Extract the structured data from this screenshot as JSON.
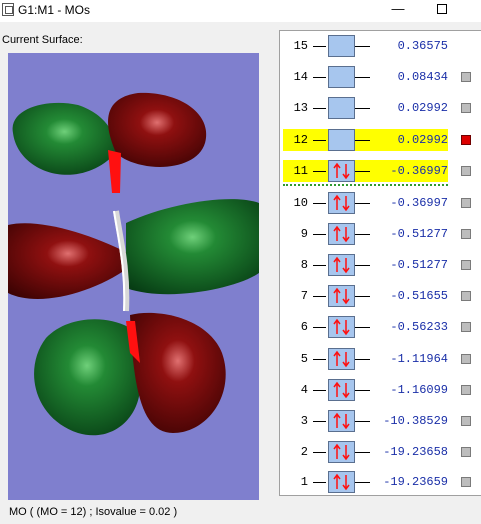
{
  "window": {
    "title": "G1:M1 - MOs",
    "minimize_glyph": "—",
    "maximize_glyph": ""
  },
  "surface": {
    "label": "Current Surface:",
    "status": "MO ( (MO = 12) ; Isovalue = 0.02 )",
    "colors": {
      "background": "#7f7fce",
      "positive_lobe": "#0f6a25",
      "negative_lobe": "#7a0707",
      "bond": "#cccccc"
    }
  },
  "orbitals": [
    {
      "number": "15",
      "energy": "0.36575",
      "occupied": false,
      "highlighted": false,
      "checkbox": false,
      "selected": false
    },
    {
      "number": "14",
      "energy": "0.08434",
      "occupied": false,
      "highlighted": false,
      "checkbox": true,
      "selected": false
    },
    {
      "number": "13",
      "energy": "0.02992",
      "occupied": false,
      "highlighted": false,
      "checkbox": true,
      "selected": false
    },
    {
      "number": "12",
      "energy": "0.02992",
      "occupied": false,
      "highlighted": true,
      "checkbox": true,
      "selected": true
    },
    {
      "number": "11",
      "energy": "-0.36997",
      "occupied": true,
      "highlighted": true,
      "checkbox": true,
      "selected": false
    },
    {
      "number": "10",
      "energy": "-0.36997",
      "occupied": true,
      "highlighted": false,
      "checkbox": true,
      "selected": false
    },
    {
      "number": "9",
      "energy": "-0.51277",
      "occupied": true,
      "highlighted": false,
      "checkbox": true,
      "selected": false
    },
    {
      "number": "8",
      "energy": "-0.51277",
      "occupied": true,
      "highlighted": false,
      "checkbox": true,
      "selected": false
    },
    {
      "number": "7",
      "energy": "-0.51655",
      "occupied": true,
      "highlighted": false,
      "checkbox": true,
      "selected": false
    },
    {
      "number": "6",
      "energy": "-0.56233",
      "occupied": true,
      "highlighted": false,
      "checkbox": true,
      "selected": false
    },
    {
      "number": "5",
      "energy": "-1.11964",
      "occupied": true,
      "highlighted": false,
      "checkbox": true,
      "selected": false
    },
    {
      "number": "4",
      "energy": "-1.16099",
      "occupied": true,
      "highlighted": false,
      "checkbox": true,
      "selected": false
    },
    {
      "number": "3",
      "energy": "-10.38529",
      "occupied": true,
      "highlighted": false,
      "checkbox": true,
      "selected": false
    },
    {
      "number": "2",
      "energy": "-19.23658",
      "occupied": true,
      "highlighted": false,
      "checkbox": true,
      "selected": false
    },
    {
      "number": "1",
      "energy": "-19.23659",
      "occupied": true,
      "highlighted": false,
      "checkbox": true,
      "selected": false
    }
  ]
}
